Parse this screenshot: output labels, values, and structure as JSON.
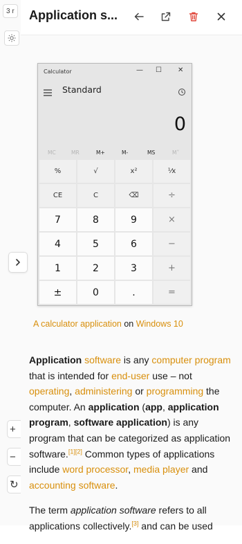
{
  "left_strip": {
    "top_label": "3 r",
    "plus_label": "+",
    "minus_label": "−",
    "refresh_label": "↻"
  },
  "header": {
    "title": "Application s..."
  },
  "calculator": {
    "window_title": "Calculator",
    "mode": "Standard",
    "display": "0",
    "memory": [
      "MC",
      "MR",
      "M+",
      "M-",
      "MS",
      "M˅"
    ],
    "keys": [
      "%",
      "√",
      "x²",
      "¹⁄x",
      "CE",
      "C",
      "⌫",
      "÷",
      "7",
      "8",
      "9",
      "×",
      "4",
      "5",
      "6",
      "−",
      "1",
      "2",
      "3",
      "+",
      "±",
      "0",
      ".",
      "="
    ]
  },
  "caption": {
    "link1": "A calculator application",
    "mid": "on",
    "link2": "Windows 10"
  },
  "article": {
    "p1": [
      {
        "t": "Application",
        "k": "b"
      },
      {
        "t": " "
      },
      {
        "t": "software",
        "k": "link"
      },
      {
        "t": " is any "
      },
      {
        "t": "computer program",
        "k": "link"
      },
      {
        "t": " that is intended for "
      },
      {
        "t": "end-user",
        "k": "link"
      },
      {
        "t": " use – not "
      },
      {
        "t": "operating",
        "k": "link"
      },
      {
        "t": ", "
      },
      {
        "t": "administering",
        "k": "link"
      },
      {
        "t": " or "
      },
      {
        "t": "programming",
        "k": "link"
      },
      {
        "t": " the computer. An "
      },
      {
        "t": "application",
        "k": "b"
      },
      {
        "t": " ("
      },
      {
        "t": "app",
        "k": "b"
      },
      {
        "t": ", "
      },
      {
        "t": "application program",
        "k": "b"
      },
      {
        "t": ", "
      },
      {
        "t": "software application",
        "k": "b"
      },
      {
        "t": ") is any program that can be categorized as application software."
      },
      {
        "t": "[1]",
        "k": "sup"
      },
      {
        "t": "[2]",
        "k": "sup"
      },
      {
        "t": " Common types of applications include "
      },
      {
        "t": "word processor",
        "k": "link"
      },
      {
        "t": ", "
      },
      {
        "t": "media player",
        "k": "link"
      },
      {
        "t": " and "
      },
      {
        "t": "accounting software",
        "k": "link"
      },
      {
        "t": "."
      }
    ],
    "p2": [
      {
        "t": "The term "
      },
      {
        "t": "application software",
        "k": "i"
      },
      {
        "t": " refers to all applications collectively."
      },
      {
        "t": "[3]",
        "k": "sup"
      },
      {
        "t": " and can be used"
      }
    ]
  },
  "colors": {
    "link": "#d88f0c",
    "delete_icon": "#e0463a"
  }
}
